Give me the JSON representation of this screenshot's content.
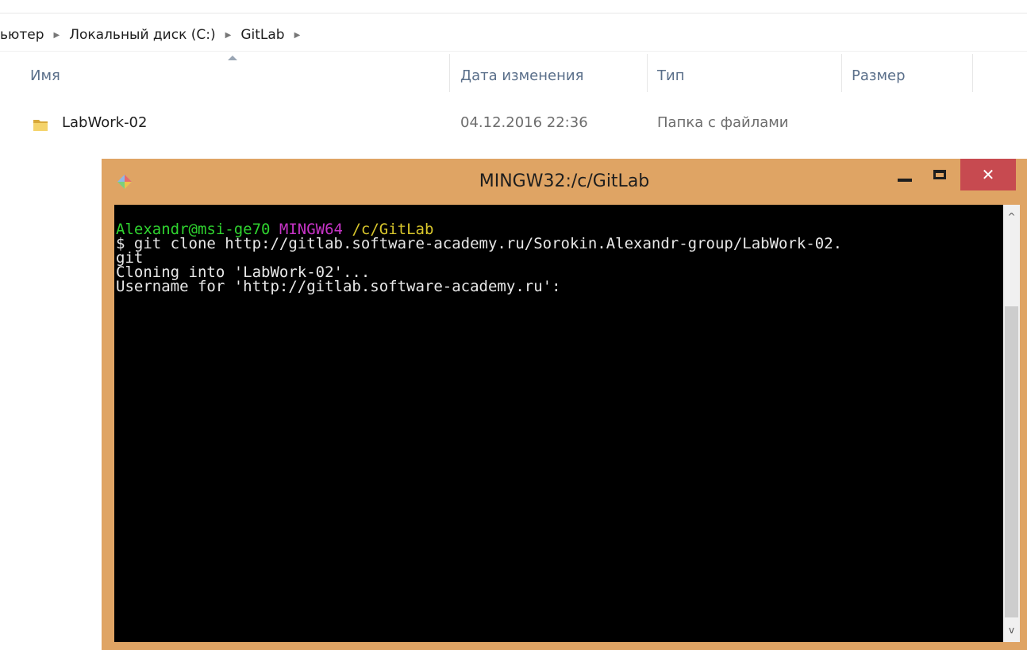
{
  "explorer": {
    "breadcrumb": [
      "ьютер",
      "Локальный диск (C:)",
      "GitLab"
    ],
    "columns": {
      "name": "Имя",
      "modified": "Дата изменения",
      "type": "Тип",
      "size": "Размер"
    },
    "rows": [
      {
        "name": "LabWork-02",
        "modified": "04.12.2016 22:36",
        "type": "Папка с файлами",
        "size": ""
      }
    ]
  },
  "terminal": {
    "title": "MINGW32:/c/GitLab",
    "prompt": {
      "user": "Alexandr@msi-ge70",
      "system": "MINGW64",
      "path": "/c/GitLab"
    },
    "lines": [
      "$ git clone http://gitlab.software-academy.ru/Sorokin.Alexandr-group/LabWork-02.",
      "git",
      "Cloning into 'LabWork-02'...",
      "Username for 'http://gitlab.software-academy.ru':"
    ],
    "controls": {
      "close": "✕"
    }
  },
  "colors": {
    "terminal_frame": "#dfa464",
    "close_button": "#c74a50",
    "prompt_user": "#2fd32f",
    "prompt_system": "#c734c7",
    "prompt_path": "#d9c72c"
  }
}
